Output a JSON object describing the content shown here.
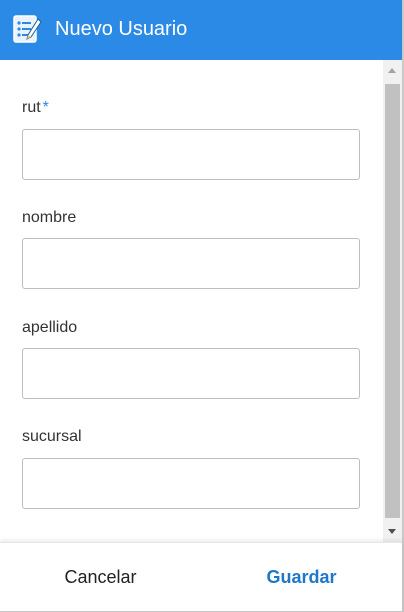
{
  "header": {
    "title": "Nuevo Usuario",
    "icon": "form-checklist-icon"
  },
  "form": {
    "fields": [
      {
        "label": "rut",
        "required_mark": "*",
        "value": ""
      },
      {
        "label": "nombre",
        "value": ""
      },
      {
        "label": "apellido",
        "value": ""
      },
      {
        "label": "sucursal",
        "value": ""
      }
    ]
  },
  "footer": {
    "cancel_label": "Cancelar",
    "save_label": "Guardar"
  },
  "colors": {
    "header_bg": "#2a8ae6",
    "accent": "#1f77c9",
    "required": "#2a8ae6"
  }
}
